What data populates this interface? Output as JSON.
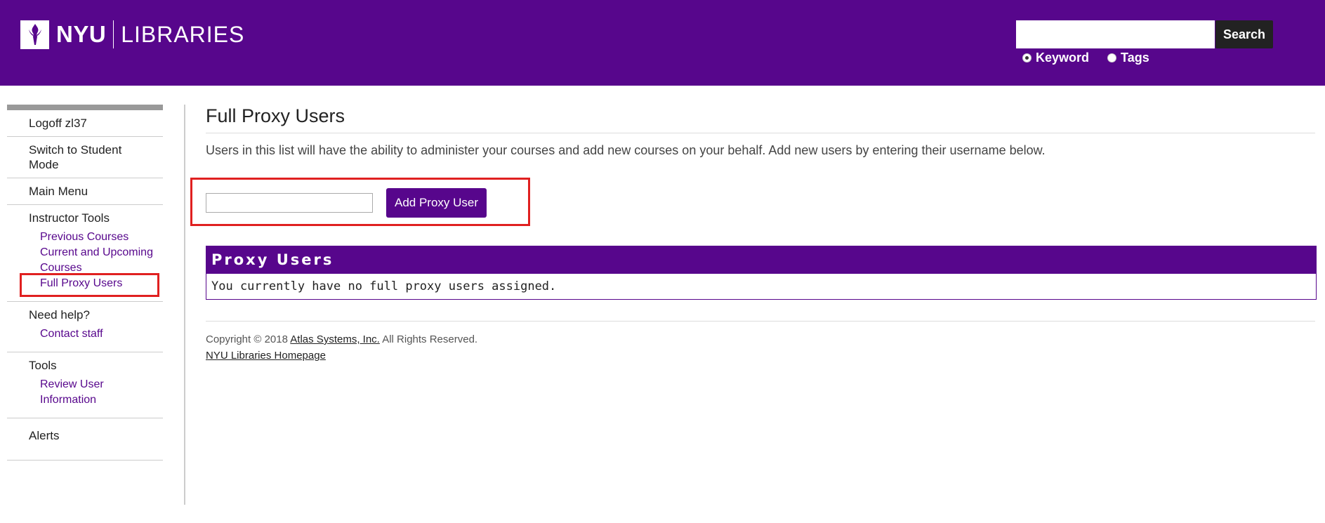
{
  "header": {
    "logo_nyu": "NYU",
    "logo_libraries": "LIBRARIES",
    "search": {
      "value": "",
      "button_label": "Search"
    },
    "search_options": [
      {
        "label": "Keyword",
        "checked": true
      },
      {
        "label": "Tags",
        "checked": false
      }
    ],
    "brand_color": "#57068c"
  },
  "sidebar": {
    "logoff": "Logoff zl37",
    "switch_mode": "Switch to Student Mode",
    "main_menu": "Main Menu",
    "instructor_tools": {
      "title": "Instructor Tools",
      "links": [
        "Previous Courses",
        "Current and Upcoming Courses",
        "Full Proxy Users"
      ]
    },
    "help": {
      "title": "Need help?",
      "links": [
        "Contact staff"
      ]
    },
    "tools": {
      "title": "Tools",
      "links": [
        "Review User Information"
      ]
    },
    "alerts": "Alerts"
  },
  "main": {
    "title": "Full Proxy Users",
    "intro": "Users in this list will have the ability to administer your courses and add new courses on your behalf. Add new users by entering their username below.",
    "proxy_input_value": "",
    "add_button_label": "Add Proxy User",
    "proxy_box": {
      "header": "Proxy Users",
      "message": "You currently have no full proxy users assigned."
    }
  },
  "footer": {
    "copyright_prefix": "Copyright © 2018",
    "company_link": "Atlas Systems, Inc.",
    "rights": "All Rights Reserved.",
    "homepage_link": "NYU Libraries Homepage"
  },
  "annotation_color": "#e02020"
}
